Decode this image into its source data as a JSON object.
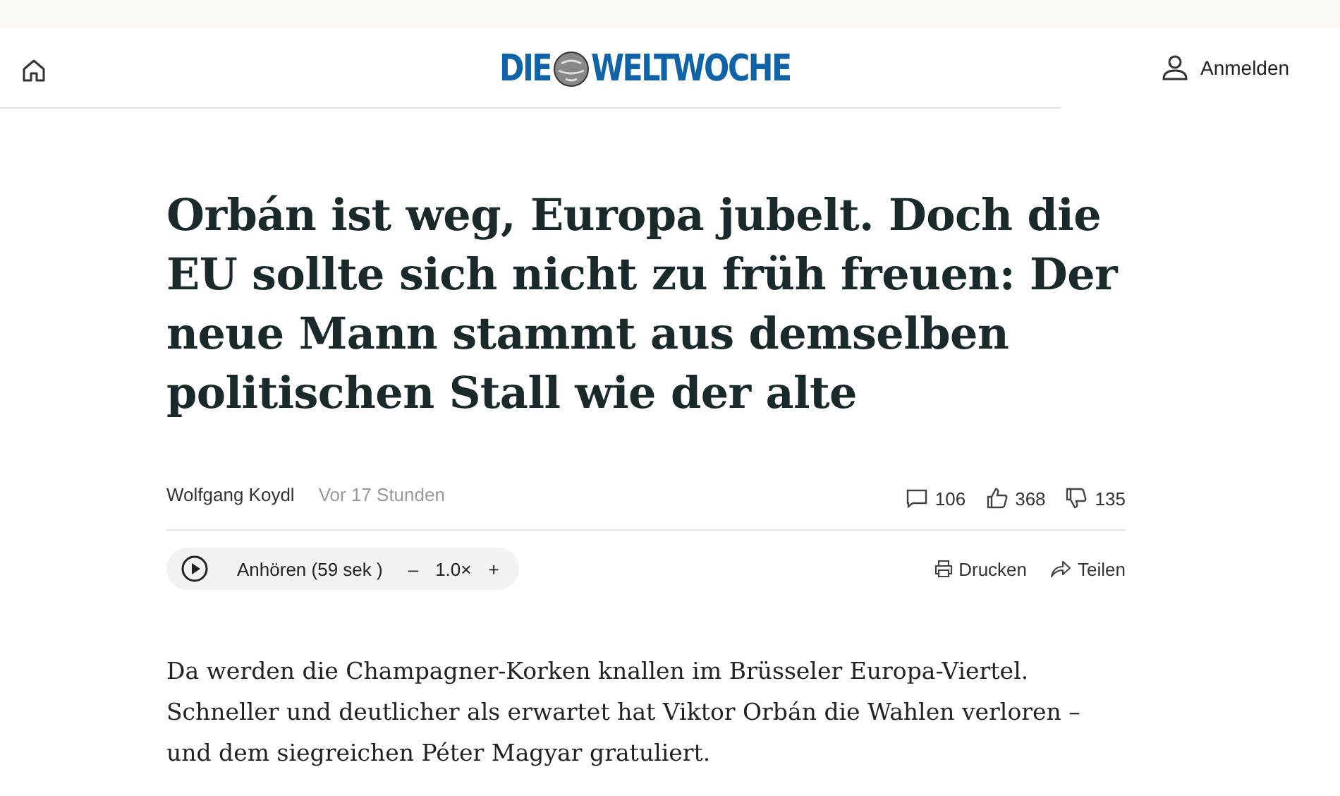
{
  "header": {
    "logo_left": "DIE",
    "logo_right": "WELTWOCHE",
    "login": "Anmelden"
  },
  "article": {
    "headline": "Orbán ist weg, Europa jubelt. Doch die EU sollte sich nicht zu früh freuen: Der neue Mann stammt aus demselben politischen Stall wie der alte",
    "author": "Wolfgang Koydl",
    "time": "Vor 17 Stunden",
    "comments": "106",
    "likes": "368",
    "dislikes": "135",
    "player": {
      "label": "Anhören (59 sek )",
      "minus": "–",
      "speed": "1.0×",
      "plus": "+"
    },
    "print": "Drucken",
    "share": "Teilen",
    "body": "Da werden die Champagner-Korken knallen im Brüsseler Europa-Viertel. Schneller und deutlicher als erwartet hat Viktor Orbán die Wahlen verloren – und dem siegreichen Péter Magyar gratuliert."
  }
}
